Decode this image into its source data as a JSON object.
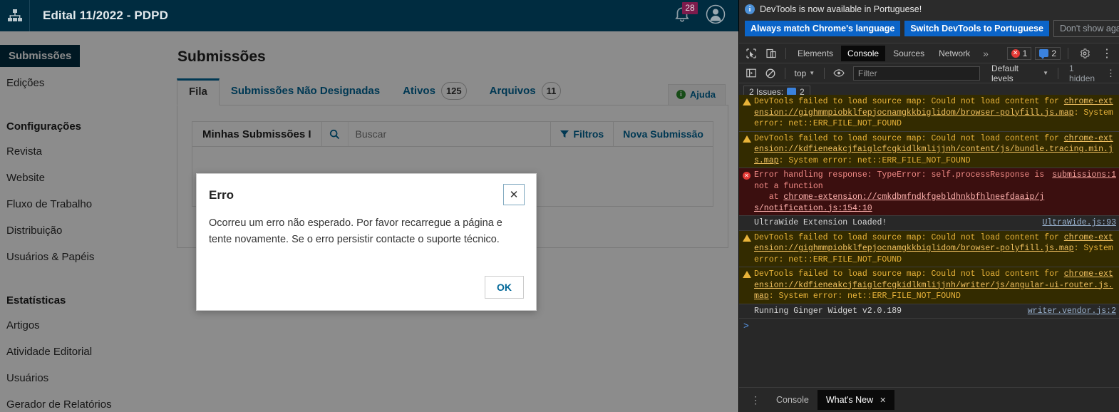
{
  "ojs": {
    "header": {
      "logo_icon": "sitemap-icon",
      "title": "Edital 11/2022 - PDPD",
      "notification_icon": "bell-icon",
      "notification_count": "28",
      "avatar_icon": "user-avatar-icon"
    },
    "sidebar": {
      "primary": [
        {
          "label": "Submissões",
          "active": true
        },
        {
          "label": "Edições",
          "active": false
        }
      ],
      "settings_heading": "Configurações",
      "settings": [
        {
          "label": "Revista"
        },
        {
          "label": "Website"
        },
        {
          "label": "Fluxo de Trabalho"
        },
        {
          "label": "Distribuição"
        },
        {
          "label": "Usuários & Papéis"
        }
      ],
      "stats_heading": "Estatísticas",
      "stats": [
        {
          "label": "Artigos"
        },
        {
          "label": "Atividade Editorial"
        },
        {
          "label": "Usuários"
        },
        {
          "label": "Gerador de Relatórios"
        }
      ]
    },
    "main": {
      "page_title": "Submissões",
      "tabs": [
        {
          "label": "Fila",
          "count": null,
          "active": true
        },
        {
          "label": "Submissões Não Designadas",
          "count": null,
          "active": false
        },
        {
          "label": "Ativos",
          "count": "125",
          "active": false
        },
        {
          "label": "Arquivos",
          "count": "11",
          "active": false
        }
      ],
      "help_tab": {
        "label": "Ajuda",
        "icon": "info-circle-icon",
        "glyph": "i"
      },
      "listing": {
        "title": "Minhas Submissões I",
        "search_icon": "search-icon",
        "search_value": "",
        "search_placeholder": "Buscar",
        "filters_label": "Filtros",
        "filters_icon": "funnel-icon",
        "new_submission_label": "Nova Submissão"
      }
    },
    "modal": {
      "title": "Erro",
      "close_icon": "close-icon",
      "close_glyph": "✕",
      "message": "Ocorreu um erro não esperado. Por favor recarregue a página e tente novamente. Se o erro persistir contacte o suporte técnico.",
      "ok_label": "OK"
    },
    "colors": {
      "header_bg": "#002c40",
      "accent": "#006798",
      "badge": "#7d1b4c"
    }
  },
  "devtools": {
    "notice": {
      "icon": "info-circle-icon",
      "text": "DevTools is now available in Portuguese!",
      "buttons": [
        {
          "label": "Always match Chrome's language",
          "style": "primary"
        },
        {
          "label": "Switch DevTools to Portuguese",
          "style": "primary"
        },
        {
          "label": "Don't show again",
          "style": "ghost"
        }
      ]
    },
    "toolbar": {
      "inspect_icon": "inspect-element-icon",
      "device_icon": "device-toolbar-icon",
      "tabs": [
        {
          "label": "Elements",
          "active": false
        },
        {
          "label": "Console",
          "active": true
        },
        {
          "label": "Sources",
          "active": false
        },
        {
          "label": "Network",
          "active": false
        }
      ],
      "more_glyph": "»",
      "error_count": "1",
      "warning_count": "2",
      "settings_icon": "gear-icon",
      "menu_icon": "kebab-menu-icon"
    },
    "filterbar": {
      "sidebar_icon": "console-sidebar-icon",
      "clear_icon": "clear-console-icon",
      "context": "top",
      "eye_icon": "live-expression-icon",
      "filter_value": "",
      "filter_placeholder": "Filter",
      "levels_label": "Default levels",
      "hidden_label": "1 hidden",
      "settings_glyph": "⋮"
    },
    "issues_bar": {
      "label": "2 Issues:",
      "count": "2",
      "icon": "issues-icon"
    },
    "console_messages": [
      {
        "level": "warn",
        "icon": "warning-triangle-icon",
        "parts": [
          {
            "t": "DevTools failed to load source map: Could not load content for ",
            "link": false
          },
          {
            "t": "chrome-extension://gighmmpiobklfepjocnamgkkbiglidom/browser-polyfill.js.map",
            "link": true
          },
          {
            "t": ": System error: net::ERR_FILE_NOT_FOUND",
            "link": false
          }
        ],
        "source": ""
      },
      {
        "level": "warn",
        "icon": "warning-triangle-icon",
        "parts": [
          {
            "t": "DevTools failed to load source map: Could not load content for ",
            "link": false
          },
          {
            "t": "chrome-extension://kdfieneakcjfaiglcfcgkidlkmlijjnh/content/js/bundle.tracing.min.js.map",
            "link": true
          },
          {
            "t": ": System error: net::ERR_FILE_NOT_FOUND",
            "link": false
          }
        ],
        "source": ""
      },
      {
        "level": "err",
        "icon": "error-circle-icon",
        "parts": [
          {
            "t": "Error handling response: TypeError: self.processResponse is not a function",
            "link": false
          },
          {
            "t": "\n    at ",
            "link": false
          },
          {
            "t": "chrome-extension://cmkdbmfndkfgebldhnkbfhlneefdaaip/js/notification.js:154:10",
            "link": true
          }
        ],
        "source": "submissions:1"
      },
      {
        "level": "info",
        "icon": "",
        "parts": [
          {
            "t": "UltraWide Extension Loaded!",
            "link": false
          }
        ],
        "source": "UltraWide.js:93"
      },
      {
        "level": "warn",
        "icon": "warning-triangle-icon",
        "parts": [
          {
            "t": "DevTools failed to load source map: Could not load content for ",
            "link": false
          },
          {
            "t": "chrome-extension://gighmmpiobklfepjocnamgkkbiglidom/browser-polyfill.js.map",
            "link": true
          },
          {
            "t": ": System error: net::ERR_FILE_NOT_FOUND",
            "link": false
          }
        ],
        "source": ""
      },
      {
        "level": "warn",
        "icon": "warning-triangle-icon",
        "parts": [
          {
            "t": "DevTools failed to load source map: Could not load content for ",
            "link": false
          },
          {
            "t": "chrome-extension://kdfieneakcjfaiglcfcgkidlkmlijjnh/writer/js/angular-ui-router.js.map",
            "link": true
          },
          {
            "t": ": System error: net::ERR_FILE_NOT_FOUND",
            "link": false
          }
        ],
        "source": ""
      },
      {
        "level": "info",
        "icon": "",
        "parts": [
          {
            "t": "Running Ginger Widget v2.0.189",
            "link": false
          }
        ],
        "source": "writer.vendor.js:2"
      }
    ],
    "prompt_glyph": ">",
    "drawer": {
      "kebab_glyph": "⋮",
      "tabs": [
        {
          "label": "Console",
          "active": false,
          "closable": false
        },
        {
          "label": "What's New",
          "active": true,
          "closable": true
        }
      ],
      "close_glyph": "✕"
    }
  }
}
